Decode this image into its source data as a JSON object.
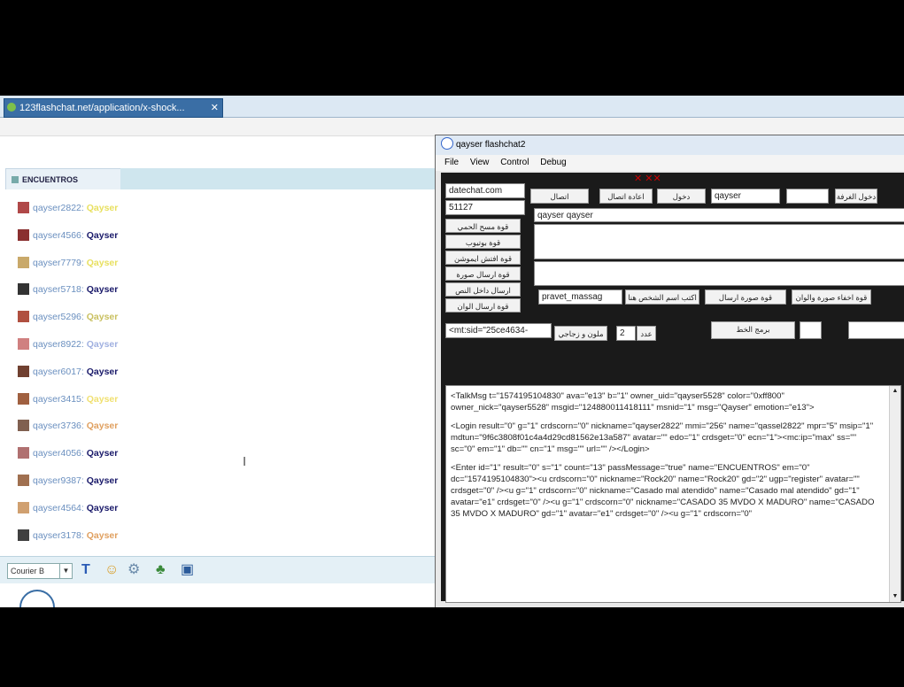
{
  "browser": {
    "tab_title": "123flashchat.net/application/x-shock...",
    "close": "✕"
  },
  "chat": {
    "room_name": "ENCUENTROS",
    "messages": [
      {
        "nick": "qayser2822:",
        "text": "Qayser",
        "text_color": "#e8e060",
        "avatar_color": "#b04848"
      },
      {
        "nick": "qayser4566:",
        "text": "Qayser",
        "text_color": "#1a1a6a",
        "avatar_color": "#8a3030"
      },
      {
        "nick": "qayser7779:",
        "text": "Qayser",
        "text_color": "#e8e060",
        "avatar_color": "#c9a96a"
      },
      {
        "nick": "qayser5718:",
        "text": "Qayser",
        "text_color": "#1a1a6a",
        "avatar_color": "#333333"
      },
      {
        "nick": "qayser5296:",
        "text": "Qayser",
        "text_color": "#c9c060",
        "avatar_color": "#b05040"
      },
      {
        "nick": "qayser8922:",
        "text": "Qayser",
        "text_color": "#a0b0e0",
        "avatar_color": "#d08080"
      },
      {
        "nick": "qayser6017:",
        "text": "Qayser",
        "text_color": "#1a1a6a",
        "avatar_color": "#704030"
      },
      {
        "nick": "qayser3415:",
        "text": "Qayser",
        "text_color": "#f0e070",
        "avatar_color": "#a06040"
      },
      {
        "nick": "qayser3736:",
        "text": "Qayser",
        "text_color": "#e0a060",
        "avatar_color": "#806050"
      },
      {
        "nick": "qayser4056:",
        "text": "Qayser",
        "text_color": "#1a1a6a",
        "avatar_color": "#b07070"
      },
      {
        "nick": "qayser9387:",
        "text": "Qayser",
        "text_color": "#1a1a6a",
        "avatar_color": "#a07050"
      },
      {
        "nick": "qayser4564:",
        "text": "Qayser",
        "text_color": "#1a1a6a",
        "avatar_color": "#d0a070"
      },
      {
        "nick": "qayser3178:",
        "text": "Qayser",
        "text_color": "#e0a060",
        "avatar_color": "#404040"
      }
    ],
    "cursor": "I",
    "font_select": "Courier B",
    "toolbar_icons": [
      "T",
      "☺",
      "⚙",
      "♣",
      "▣"
    ]
  },
  "flashchat": {
    "title": "qayser flashchat2",
    "menu": [
      "File",
      "View",
      "Control",
      "Debug"
    ],
    "server": "datechat.com",
    "port": "51127",
    "username": "qayser",
    "connect": "اتصال",
    "reconnect": "اعادة اتصال",
    "login": "دخول",
    "enter_room": "دخول الغرفة",
    "display_name": "qayser qayser",
    "left_buttons": [
      "قوة مسح الحمي",
      "قوة بوتيوب",
      "قوة افتش ايموشن",
      "قوة ارسال صورة",
      "ارسال داخل النص",
      "قوة ارسال الوان"
    ],
    "private_field": "pravet_massag",
    "private_label": "اكتب اسم الشخص هنا",
    "btn_image_url": "قوة صورة ارسال",
    "btn_hide_image": "قوة اخفاء صورة والوان",
    "uid_field": "<mt:sid=\"25ce4634-",
    "color_btn": "ملون و زجاجي",
    "num_field": "2",
    "num_label": "عدد",
    "exit_btn": "برمج الخط",
    "log": [
      "<TalkMsg t=\"1574195104830\" ava=\"e13\" b=\"1\" owner_uid=\"qayser5528\" color=\"0xff800\" owner_nick=\"qayser5528\" msgid=\"124880011418111\" msnid=\"1\" msg=\"Qayser\" emotion=\"e13\">",
      "<Login result=\"0\" g=\"1\" crdscorn=\"0\" nickname=\"qayser2822\" mmi=\"256\" name=\"qassel2822\" mpr=\"5\" msip=\"1\" mdtun=\"9f6c3808f01c4a4d29cd81562e13a587\" avatar=\"\" edo=\"1\" crdsget=\"0\" ecn=\"1\"><mc:ip=\"max\" ss=\"\" sc=\"0\" em=\"1\" db=\"\" cn=\"1\" msg=\"\" url=\"\" /></Login>",
      "<Enter id=\"1\" result=\"0\" s=\"1\" count=\"13\" passMessage=\"true\" name=\"ENCUENTROS\" em=\"0\" dc=\"1574195104830\"><u crdscorn=\"0\" nickname=\"Rock20\" name=\"Rock20\" gd=\"2\" ugp=\"register\" avatar=\"\" crdsget=\"0\" /><u g=\"1\" crdscorn=\"0\" nickname=\"Casado mal atendido\" name=\"Casado mal atendido\" gd=\"1\" avatar=\"e1\" crdsget=\"0\" /><u g=\"1\" crdscorn=\"0\" nickname=\"CASADO 35 MVDO X MADURO\" name=\"CASADO 35 MVDO X MADURO\" gd=\"1\" avatar=\"e1\" crdsget=\"0\" /><u g=\"1\" crdscorn=\"0\""
    ]
  }
}
